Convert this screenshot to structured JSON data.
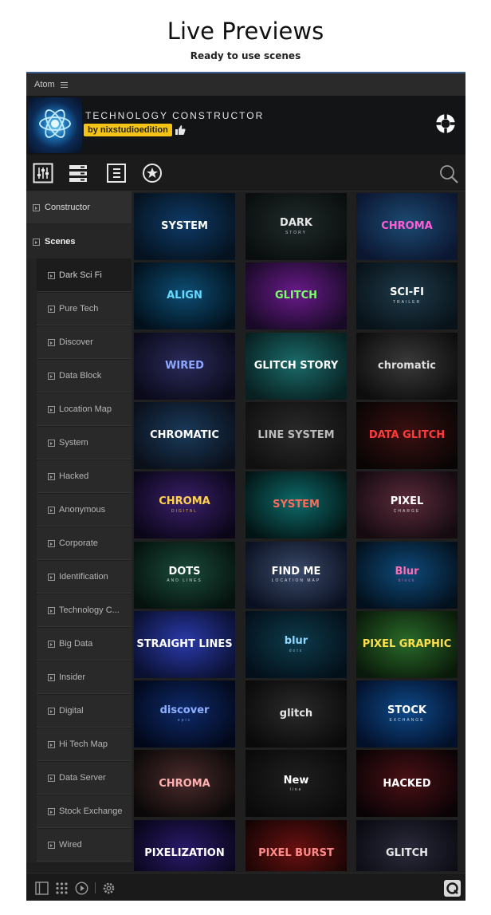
{
  "page": {
    "title": "Live Previews",
    "subtitle": "Ready to use scenes"
  },
  "menubar": {
    "app_label": "Atom"
  },
  "header": {
    "app_name": "TECHNOLOGY CONSTRUCTOR",
    "author": "by nixstudioedition"
  },
  "sidebar": {
    "constructor_label": "Constructor",
    "scenes_label": "Scenes",
    "scenes": [
      "Dark Sci Fi",
      "Pure Tech",
      "Discover",
      "Data Block",
      "Location Map",
      "System",
      "Hacked",
      "Anonymous",
      "Corporate",
      "Identification",
      "Technology C...",
      "Big Data",
      "Insider",
      "Digital",
      "Hi Tech Map",
      "Data Server",
      "Stock Exchange",
      "Wired"
    ]
  },
  "thumbnails": [
    {
      "main": "SYSTEM",
      "sub": "",
      "bg": "#0e3a66",
      "bg2": "#05121f",
      "fg": "#ffffff"
    },
    {
      "main": "DARK",
      "sub": "STORY",
      "bg": "#1f2a2a",
      "bg2": "#0a0d0d",
      "fg": "#e6e6e6"
    },
    {
      "main": "CHROMA",
      "sub": "",
      "bg": "#1c4a73",
      "bg2": "#0b1630",
      "fg": "#ff5fd6"
    },
    {
      "main": "ALIGN",
      "sub": "",
      "bg": "#0d4d73",
      "bg2": "#02101c",
      "fg": "#66d9ff"
    },
    {
      "main": "GLITCH",
      "sub": "",
      "bg": "#6a1a8a",
      "bg2": "#180a26",
      "fg": "#7dff6b"
    },
    {
      "main": "SCI-FI",
      "sub": "TRAILER",
      "bg": "#1e3a4a",
      "bg2": "#081218",
      "fg": "#ffffff"
    },
    {
      "main": "WIRED",
      "sub": "",
      "bg": "#2a2a5a",
      "bg2": "#0a0a1a",
      "fg": "#8fa8ff"
    },
    {
      "main": "GLITCH STORY",
      "sub": "",
      "bg": "#1b6b6b",
      "bg2": "#082020",
      "fg": "#ffffff"
    },
    {
      "main": "chromatic",
      "sub": "",
      "bg": "#3a3a3a",
      "bg2": "#0d0d0d",
      "fg": "#dddddd"
    },
    {
      "main": "CHROMATIC",
      "sub": "",
      "bg": "#1a3a5a",
      "bg2": "#0a0f1a",
      "fg": "#ffffff"
    },
    {
      "main": "LINE SYSTEM",
      "sub": "",
      "bg": "#2a2a2a",
      "bg2": "#101010",
      "fg": "#bbbbbb"
    },
    {
      "main": "DATA GLITCH",
      "sub": "",
      "bg": "#3a1010",
      "bg2": "#0a0505",
      "fg": "#ff3b3b"
    },
    {
      "main": "CHROMA",
      "sub": "DIGITAL",
      "bg": "#3a1f6a",
      "bg2": "#0a0618",
      "fg": "#ffd34d"
    },
    {
      "main": "SYSTEM",
      "sub": "",
      "bg": "#0e6a6a",
      "bg2": "#031414",
      "fg": "#ff6b5b"
    },
    {
      "main": "PIXEL",
      "sub": "CHARGE",
      "bg": "#5a2a3a",
      "bg2": "#140a10",
      "fg": "#ffffff"
    },
    {
      "main": "DOTS",
      "sub": "AND LINES",
      "bg": "#1a4a3a",
      "bg2": "#05120e",
      "fg": "#ffffff"
    },
    {
      "main": "FIND ME",
      "sub": "LOCATION MAP",
      "bg": "#3a4a6a",
      "bg2": "#0a1020",
      "fg": "#ffffff"
    },
    {
      "main": "Blur",
      "sub": "block",
      "bg": "#0e4a7a",
      "bg2": "#03101c",
      "fg": "#ff6bb0"
    },
    {
      "main": "STRAIGHT LINES",
      "sub": "",
      "bg": "#2a3aaa",
      "bg2": "#0a1030",
      "fg": "#ffffff"
    },
    {
      "main": "blur",
      "sub": "dots",
      "bg": "#0e3a4a",
      "bg2": "#03101a",
      "fg": "#8fd6ff"
    },
    {
      "main": "PIXEL GRAPHIC",
      "sub": "",
      "bg": "#2a6a2a",
      "bg2": "#0a1a0a",
      "fg": "#ffe04d"
    },
    {
      "main": "discover",
      "sub": "epic",
      "bg": "#0e2a6a",
      "bg2": "#02081a",
      "fg": "#8fb0ff"
    },
    {
      "main": "glitch",
      "sub": "",
      "bg": "#2a2a2a",
      "bg2": "#0a0a0a",
      "fg": "#e6e6e6"
    },
    {
      "main": "STOCK",
      "sub": "EXCHANGE",
      "bg": "#0e4a8a",
      "bg2": "#03102a",
      "fg": "#ffffff"
    },
    {
      "main": "CHROMA",
      "sub": "",
      "bg": "#4a2a2a",
      "bg2": "#0a0808",
      "fg": "#ffb0b0"
    },
    {
      "main": "New",
      "sub": "line",
      "bg": "#1f1f1f",
      "bg2": "#0a0a0a",
      "fg": "#ffffff"
    },
    {
      "main": "HACKED",
      "sub": "",
      "bg": "#4a1014",
      "bg2": "#0a0306",
      "fg": "#ffffff"
    },
    {
      "main": "PIXELIZATION",
      "sub": "",
      "bg": "#2a1a6a",
      "bg2": "#080518",
      "fg": "#ffffff"
    },
    {
      "main": "PIXEL BURST",
      "sub": "",
      "bg": "#6a1010",
      "bg2": "#140404",
      "fg": "#ff8a8a"
    },
    {
      "main": "GLITCH",
      "sub": "",
      "bg": "#2a2a3a",
      "bg2": "#0a0a12",
      "fg": "#e6e6e6"
    }
  ],
  "colors": {
    "accent": "#3a5b8c",
    "badge": "#f3c316"
  },
  "icons": {
    "toolbar": [
      "sliders-icon",
      "layers-icon",
      "list-icon",
      "star-icon",
      "search-icon"
    ],
    "status": [
      "panel-icon",
      "grid-icon",
      "play-icon",
      "gear-icon",
      "logo-icon"
    ]
  }
}
